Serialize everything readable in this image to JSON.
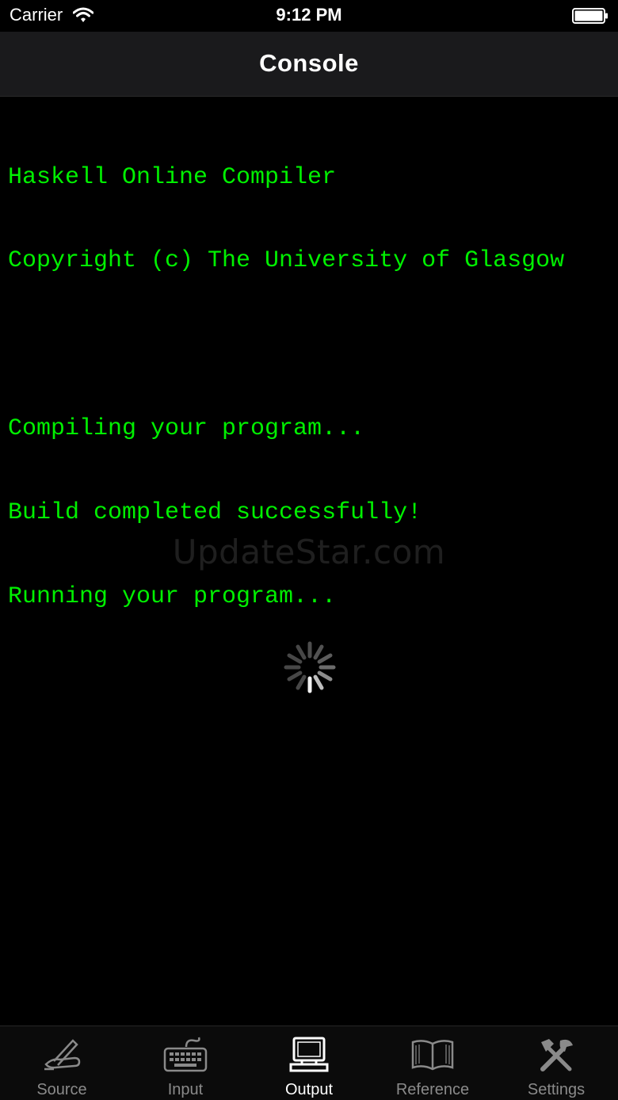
{
  "status_bar": {
    "carrier": "Carrier",
    "time": "9:12 PM"
  },
  "nav": {
    "title": "Console"
  },
  "console": {
    "text_color": "#00f000",
    "lines": [
      "Haskell Online Compiler",
      "Copyright (c) The University of Glasgow",
      "",
      "Compiling your program...",
      "Build completed successfully!",
      "Running your program..."
    ]
  },
  "watermark": "UpdateStar.com",
  "loading": {
    "icon": "activity-spinner-icon"
  },
  "tabs": [
    {
      "label": "Source",
      "icon": "pen-hand-icon",
      "active": false
    },
    {
      "label": "Input",
      "icon": "keyboard-icon",
      "active": false
    },
    {
      "label": "Output",
      "icon": "computer-icon",
      "active": true
    },
    {
      "label": "Reference",
      "icon": "book-icon",
      "active": false
    },
    {
      "label": "Settings",
      "icon": "tools-icon",
      "active": false
    }
  ]
}
